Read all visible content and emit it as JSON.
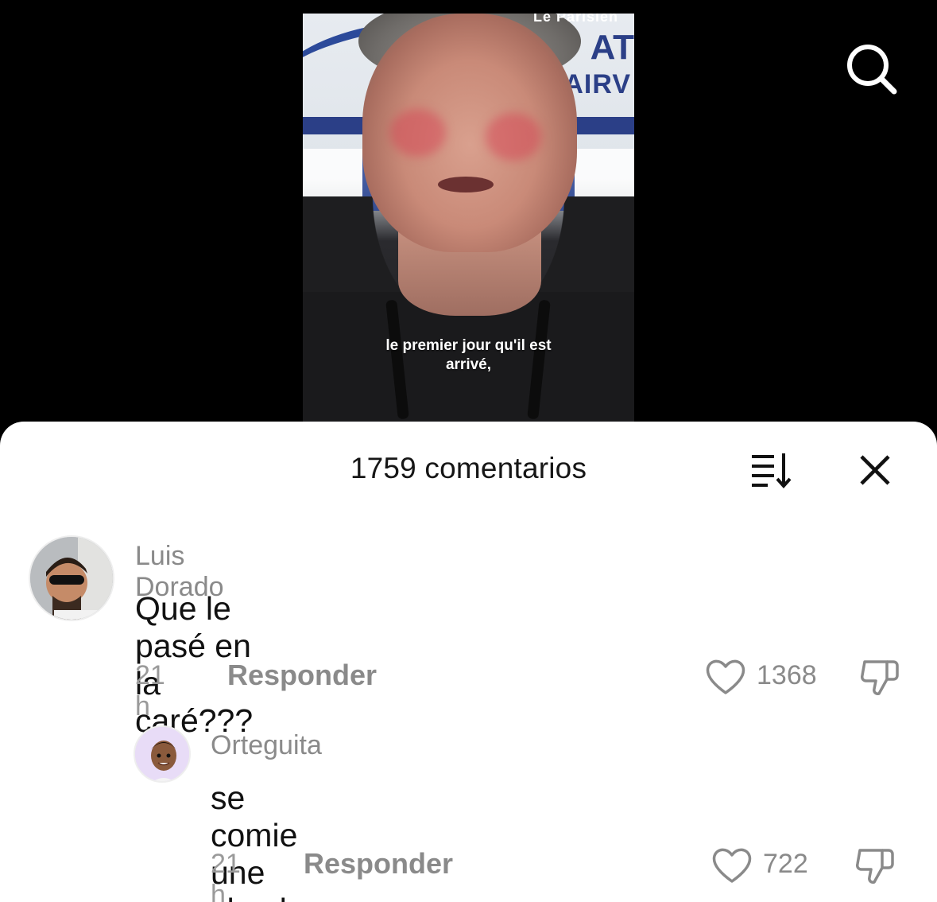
{
  "video": {
    "watermark": "Le Parisien",
    "subtitle_line1": "le premier jour qu'il est",
    "subtitle_line2": "arrivé,",
    "backdrop_text_1": "AT",
    "backdrop_text_2": "AIRV"
  },
  "header": {
    "search_icon": "search-icon"
  },
  "comments_panel": {
    "title": "1759 comentarios",
    "sort_icon": "sort-icon",
    "close_icon": "close-icon"
  },
  "comments": [
    {
      "username": "Luis Dorado",
      "text": "Que le pasé en la caré???",
      "time": "21 h",
      "reply_label": "Responder",
      "likes": "1368"
    },
    {
      "username": "Orteguita",
      "text": "se comie une choche",
      "time": "21 h",
      "reply_label": "Responder",
      "likes": "722"
    }
  ],
  "colors": {
    "sheet_bg": "#ffffff",
    "muted_text": "#8a8a8a",
    "primary_text": "#111111"
  }
}
